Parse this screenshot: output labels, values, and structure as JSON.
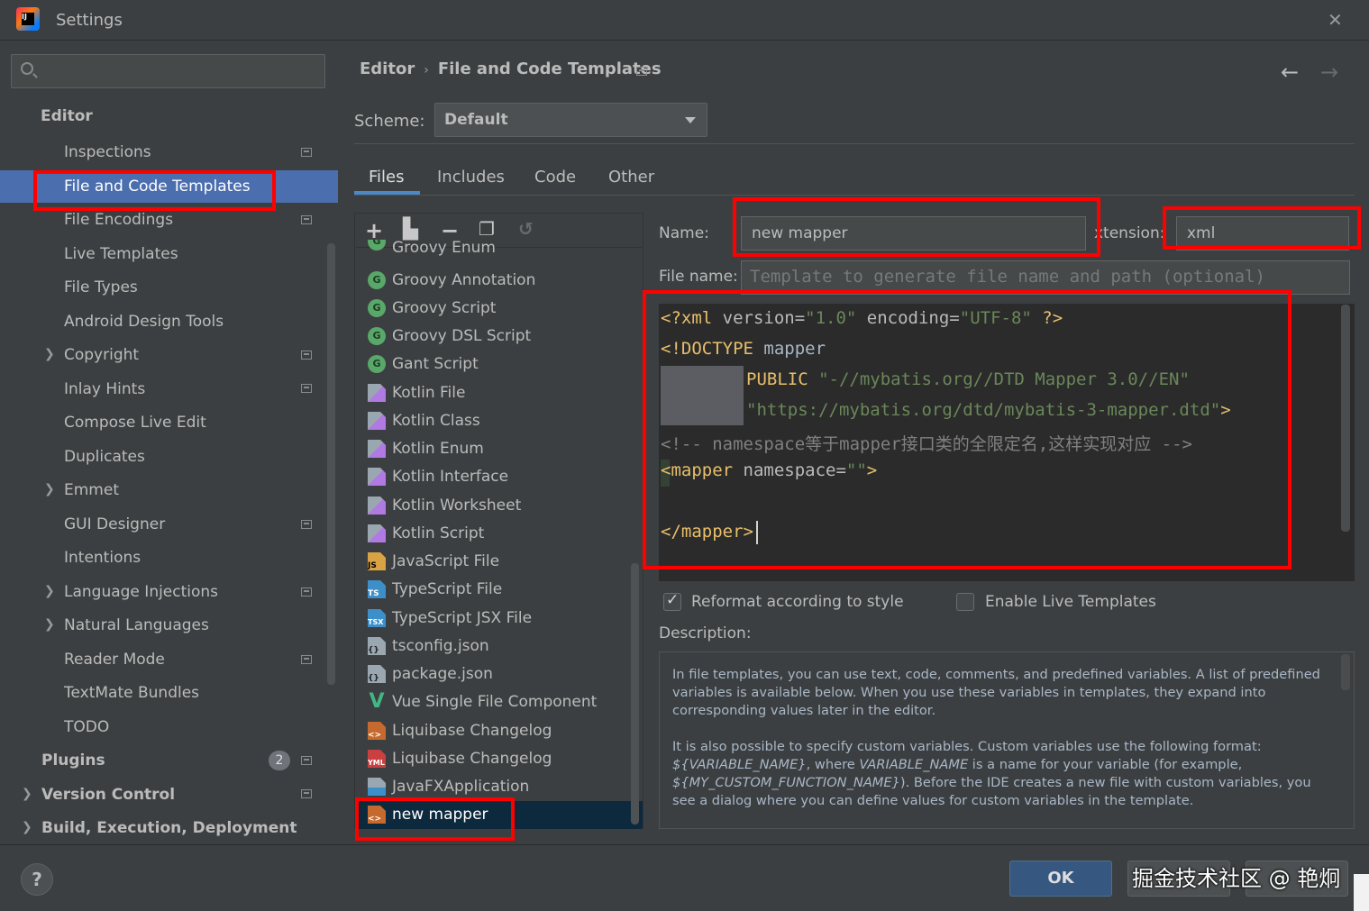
{
  "window": {
    "title": "Settings"
  },
  "sidebar": {
    "items": [
      {
        "label": "Editor"
      },
      {
        "label": "Inspections"
      },
      {
        "label": "File and Code Templates"
      },
      {
        "label": "File Encodings"
      },
      {
        "label": "Live Templates"
      },
      {
        "label": "File Types"
      },
      {
        "label": "Android Design Tools"
      },
      {
        "label": "Copyright"
      },
      {
        "label": "Inlay Hints"
      },
      {
        "label": "Compose Live Edit"
      },
      {
        "label": "Duplicates"
      },
      {
        "label": "Emmet"
      },
      {
        "label": "GUI Designer"
      },
      {
        "label": "Intentions"
      },
      {
        "label": "Language Injections"
      },
      {
        "label": "Natural Languages"
      },
      {
        "label": "Reader Mode"
      },
      {
        "label": "TextMate Bundles"
      },
      {
        "label": "TODO"
      },
      {
        "label": "Plugins"
      },
      {
        "label": "Version Control"
      },
      {
        "label": "Build, Execution, Deployment"
      }
    ],
    "plugins_badge": "2"
  },
  "breadcrumb": {
    "parent": "Editor",
    "current": "File and Code Templates"
  },
  "scheme": {
    "label": "Scheme:",
    "value": "Default"
  },
  "tabs": [
    "Files",
    "Includes",
    "Code",
    "Other"
  ],
  "templates": [
    {
      "label": "Groovy Enum"
    },
    {
      "label": "Groovy Annotation"
    },
    {
      "label": "Groovy Script"
    },
    {
      "label": "Groovy DSL Script"
    },
    {
      "label": "Gant Script"
    },
    {
      "label": "Kotlin File"
    },
    {
      "label": "Kotlin Class"
    },
    {
      "label": "Kotlin Enum"
    },
    {
      "label": "Kotlin Interface"
    },
    {
      "label": "Kotlin Worksheet"
    },
    {
      "label": "Kotlin Script"
    },
    {
      "label": "JavaScript File",
      "tag": "JS"
    },
    {
      "label": "TypeScript File",
      "tag": "TS"
    },
    {
      "label": "TypeScript JSX File",
      "tag": "TSX"
    },
    {
      "label": "tsconfig.json",
      "tag": "{}"
    },
    {
      "label": "package.json",
      "tag": "{}"
    },
    {
      "label": "Vue Single File Component",
      "tag": "V"
    },
    {
      "label": "Liquibase Changelog",
      "tag": "<>"
    },
    {
      "label": "Liquibase Changelog",
      "tag": "YML"
    },
    {
      "label": "JavaFXApplication"
    },
    {
      "label": "new mapper",
      "tag": "<>"
    }
  ],
  "form": {
    "name_label": "Name:",
    "name_value": "new mapper",
    "extension_label": "xtension:",
    "extension_value": "xml",
    "filename_label": "File name:",
    "filename_placeholder": "Template to generate file name and path (optional)"
  },
  "code": {
    "l1_a": "<?xml ",
    "l1_b": "version=",
    "l1_c": "\"1.0\"",
    "l1_d": " encoding=",
    "l1_e": "\"UTF-8\"",
    "l1_f": " ?>",
    "l2_a": "<!DOCTYPE ",
    "l2_b": "mapper",
    "l3_a": "PUBLIC ",
    "l3_b": "\"-//mybatis.org//DTD Mapper 3.0//EN\"",
    "l4_a": "\"https://mybatis.org/dtd/mybatis-3-mapper.dtd\"",
    "l4_b": ">",
    "l5": "<!-- namespace等于mapper接口类的全限定名,这样实现对应 -->",
    "l6_a": "<mapper ",
    "l6_b": "namespace=",
    "l6_c": "\"\"",
    "l6_d": ">",
    "l8": "</mapper>"
  },
  "options": {
    "reformat_label": "Reformat according to style",
    "reformat_checked": true,
    "live_templates_label": "Enable Live Templates",
    "live_templates_checked": false
  },
  "description": {
    "label": "Description:",
    "p1": "In file templates, you can use text, code, comments, and predefined variables. A list of predefined variables is available below. When you use these variables in templates, they expand into corresponding values later in the editor.",
    "p2_a": "It is also possible to specify custom variables. Custom variables use the following format: ",
    "p2_v1": "${VARIABLE_NAME}",
    "p2_b": ", where ",
    "p2_v2": "VARIABLE_NAME",
    "p2_c": " is a name for your variable (for example, ",
    "p2_v3": "${MY_CUSTOM_FUNCTION_NAME}",
    "p2_d": "). Before the IDE creates a new file with custom variables, you see a dialog where you can define values for custom variables in the template."
  },
  "buttons": {
    "help": "?",
    "ok": "OK"
  },
  "watermark": "掘金技术社区 @ 艳炯",
  "colors": {
    "selection": "#4b6eaf",
    "accent": "#4a88c7",
    "highlight_box": "#ff0000"
  }
}
